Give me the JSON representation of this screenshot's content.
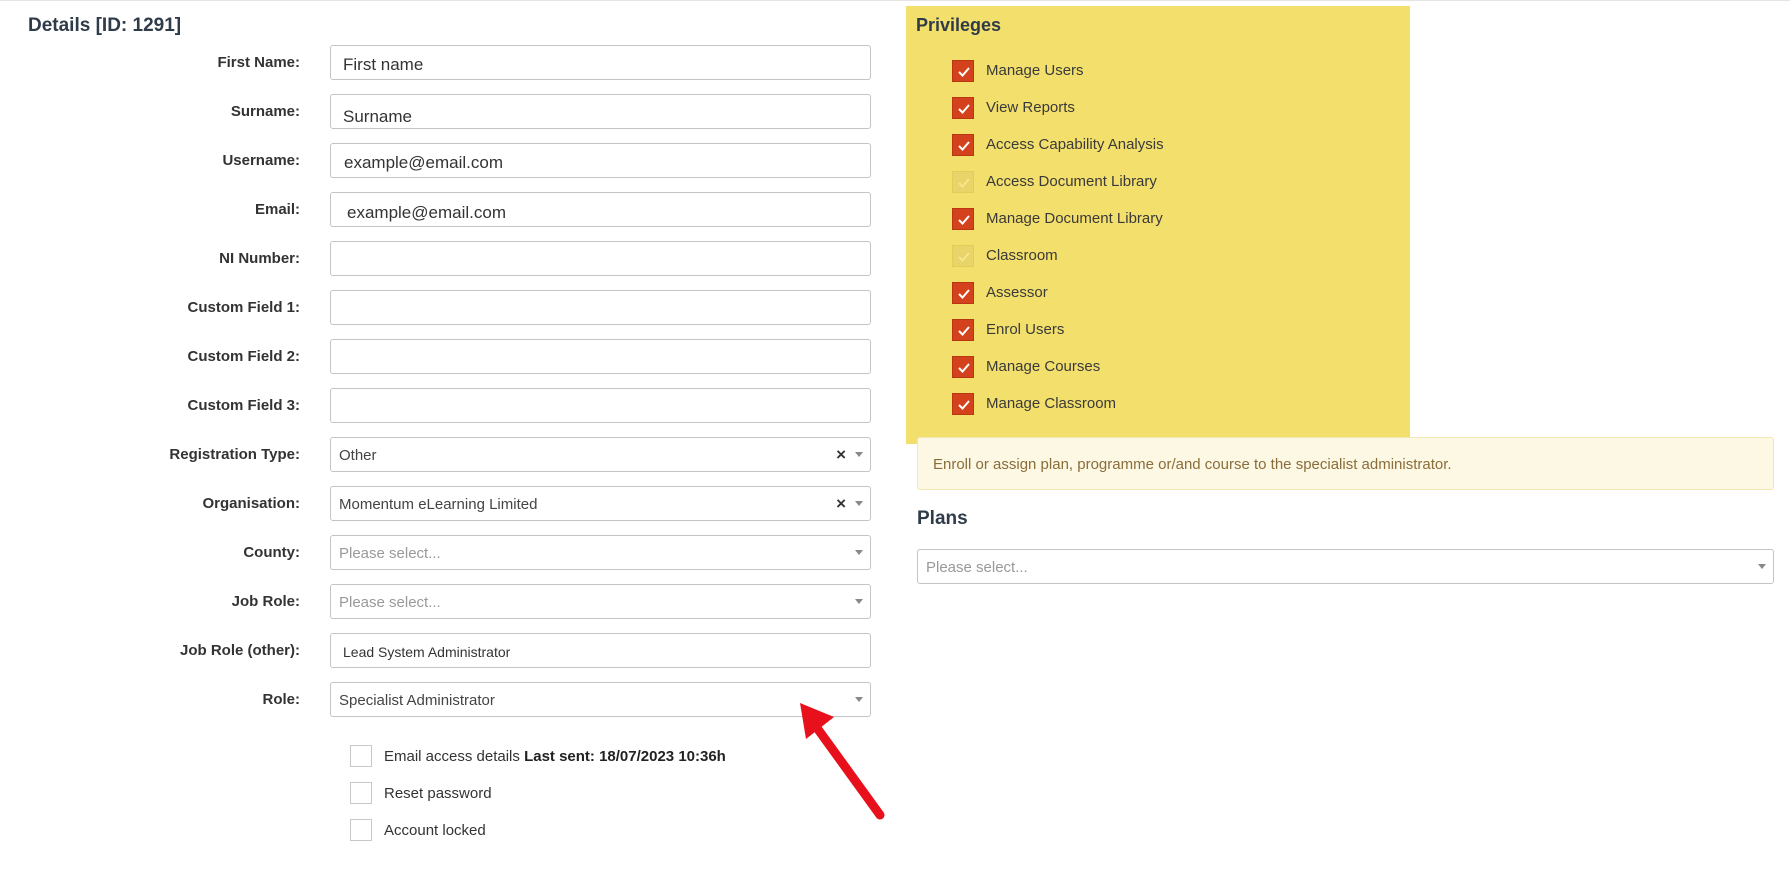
{
  "details": {
    "title": "Details [ID: 1291]",
    "fields": [
      {
        "label": "First Name:",
        "value": "First name"
      },
      {
        "label": "Surname:",
        "value": "Surname"
      },
      {
        "label": "Username:",
        "value": "example@email.com"
      },
      {
        "label": "Email:",
        "value": "example@email.com"
      },
      {
        "label": "NI Number:",
        "value": ""
      },
      {
        "label": "Custom Field 1:",
        "value": ""
      },
      {
        "label": "Custom Field 2:",
        "value": ""
      },
      {
        "label": "Custom Field 3:",
        "value": ""
      },
      {
        "label": "Registration Type:",
        "value": "Other"
      },
      {
        "label": "Organisation:",
        "value": "Momentum eLearning Limited"
      },
      {
        "label": "County:",
        "placeholder": "Please select..."
      },
      {
        "label": "Job Role:",
        "placeholder": "Please select..."
      },
      {
        "label": "Job Role (other):",
        "value": "Lead System Administrator"
      },
      {
        "label": "Role:",
        "value": "Specialist Administrator"
      }
    ],
    "clear_glyph": "×",
    "checkboxes": [
      {
        "label": "Email access details",
        "extra": "Last sent: 18/07/2023 10:36h",
        "checked": false
      },
      {
        "label": "Reset password",
        "checked": false
      },
      {
        "label": "Account locked",
        "checked": false
      }
    ]
  },
  "privileges": {
    "title": "Privileges",
    "items": [
      {
        "label": "Manage Users",
        "checked": true
      },
      {
        "label": "View Reports",
        "checked": true
      },
      {
        "label": "Access Capability Analysis",
        "checked": true
      },
      {
        "label": "Access Document Library",
        "checked": false
      },
      {
        "label": "Manage Document Library",
        "checked": true
      },
      {
        "label": "Classroom",
        "checked": false
      },
      {
        "label": "Assessor",
        "checked": true
      },
      {
        "label": "Enrol Users",
        "checked": true
      },
      {
        "label": "Manage Courses",
        "checked": true
      },
      {
        "label": "Manage Classroom",
        "checked": true
      }
    ]
  },
  "notice": {
    "text": "Enroll or assign plan, programme or/and course to the specialist administrator."
  },
  "plans": {
    "title": "Plans",
    "placeholder": "Please select..."
  },
  "colors": {
    "accent": "#d4421d",
    "highlight": "#f3df6c",
    "notice_bg": "#fcf8e3",
    "arrow": "#e8101a"
  }
}
